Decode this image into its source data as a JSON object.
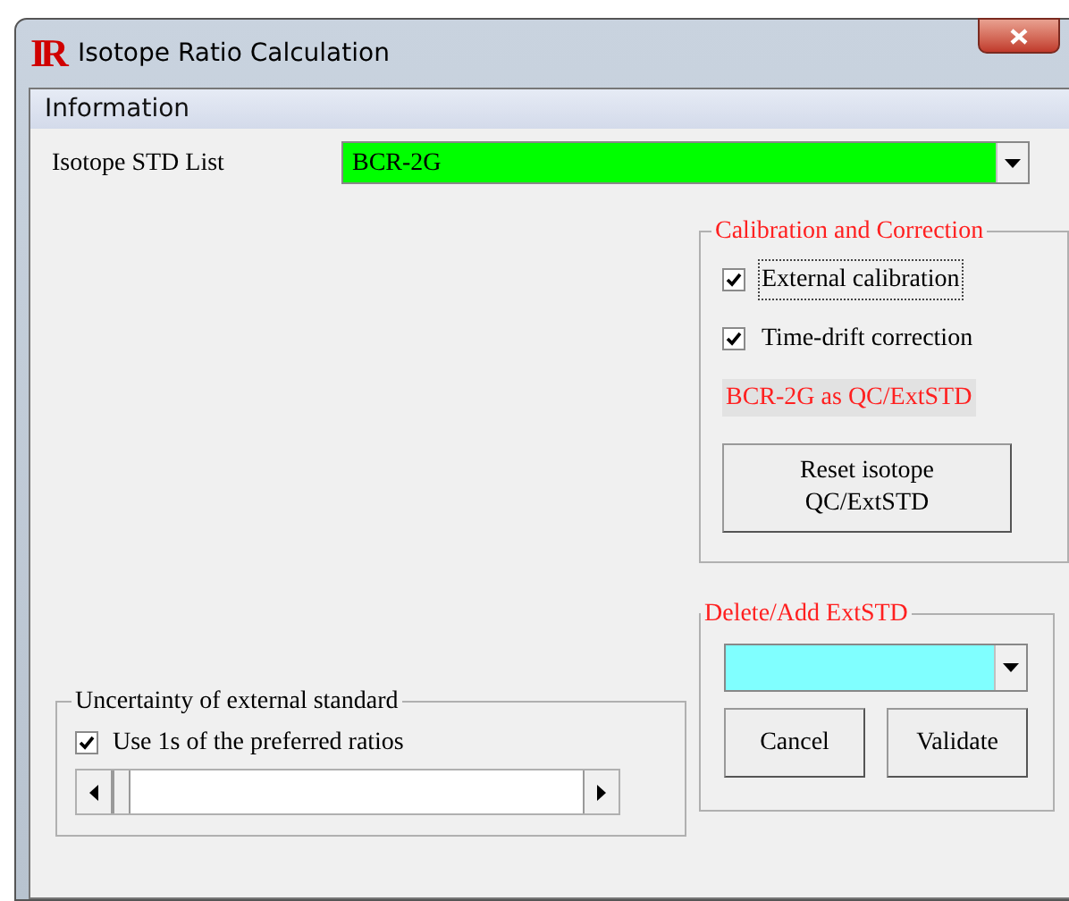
{
  "window": {
    "title": "Isotope Ratio Calculation",
    "logo": "IR"
  },
  "section": "Information",
  "std_list": {
    "label": "Isotope STD List",
    "value": "BCR-2G"
  },
  "calibration": {
    "title": "Calibration and Correction",
    "options": [
      {
        "label": "External calibration",
        "checked": true,
        "focused": true
      },
      {
        "label": "Time-drift correction",
        "checked": true,
        "focused": false
      }
    ],
    "status": "BCR-2G as QC/ExtSTD",
    "reset_button": "Reset isotope\nQC/ExtSTD"
  },
  "delete_add": {
    "title": "Delete/Add ExtSTD",
    "buttons": [
      "Cancel",
      "Validate"
    ]
  },
  "uncertainty": {
    "title": "Uncertainty of external standard",
    "option": {
      "label": "Use 1s of the preferred ratios",
      "checked": true
    }
  }
}
